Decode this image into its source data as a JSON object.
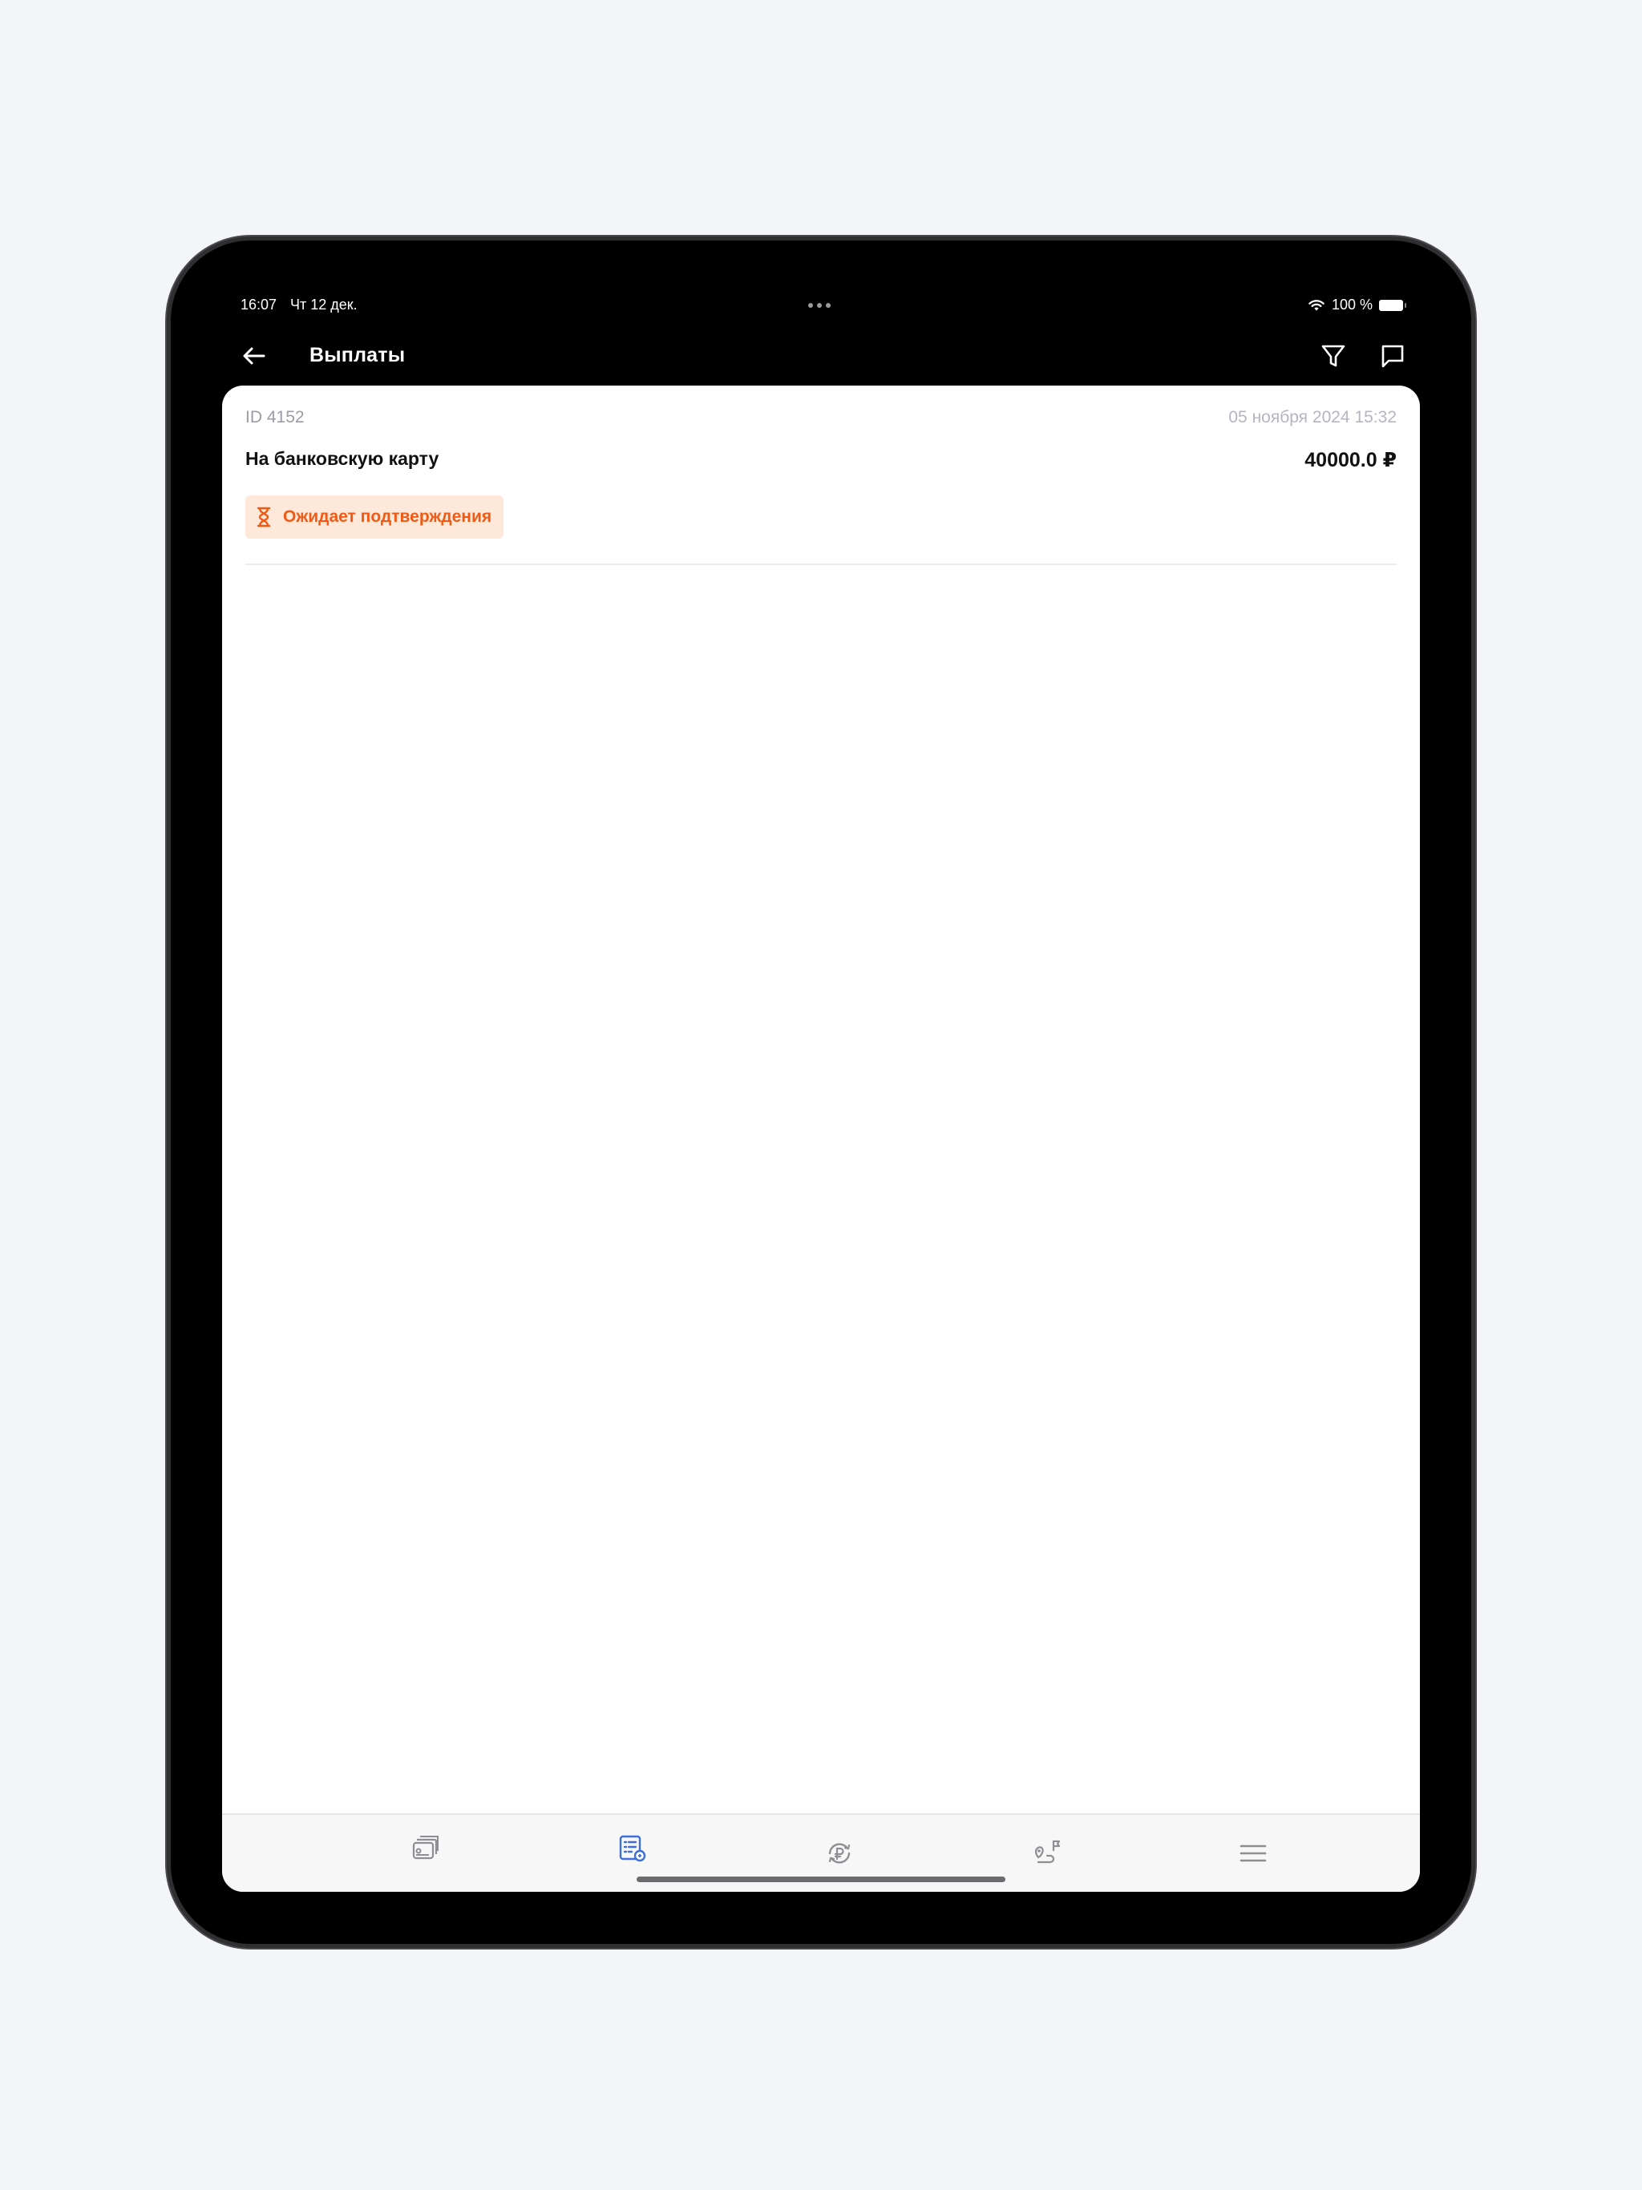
{
  "status_bar": {
    "time": "16:07",
    "date": "Чт 12 дек.",
    "battery": "100 %"
  },
  "header": {
    "title": "Выплаты",
    "icons": [
      "back-arrow-icon",
      "filter-icon",
      "chat-icon"
    ]
  },
  "payout": {
    "id": "ID 4152",
    "date": "05 ноября 2024 15:32",
    "type": "На банковскую карту",
    "amount": "40000.0 ₽",
    "status": "Ожидает подтверждения",
    "status_color": "#f05a14",
    "status_bg": "#fde8d9"
  },
  "tabbar": {
    "active_color": "#3d6fdc",
    "inactive_color": "#8e8e93",
    "tabs": [
      {
        "icon": "cards-icon",
        "active": false
      },
      {
        "icon": "payouts-list-icon",
        "active": true
      },
      {
        "icon": "ruble-exchange-icon",
        "active": false
      },
      {
        "icon": "route-icon",
        "active": false
      },
      {
        "icon": "menu-icon",
        "active": false
      }
    ]
  }
}
